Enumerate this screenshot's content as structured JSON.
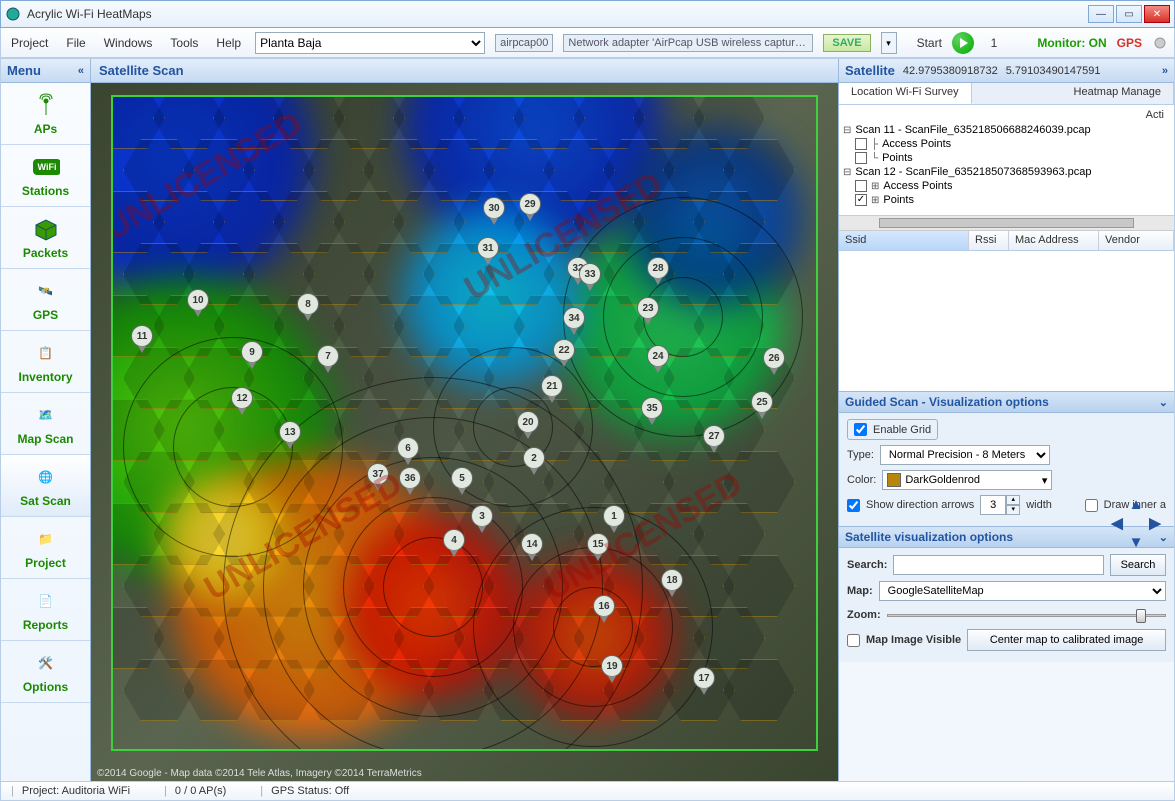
{
  "titlebar": {
    "title": "Acrylic Wi-Fi HeatMaps"
  },
  "menu": {
    "project": "Project",
    "file": "File",
    "windows": "Windows",
    "tools": "Tools",
    "help": "Help"
  },
  "toolbar": {
    "plan": "Planta Baja",
    "adapter1": "airpcap00",
    "adapter2": "Network adapter 'AirPcap USB wireless capture adapt...",
    "save": "SAVE",
    "start": "Start",
    "counter": "1",
    "monitor": "Monitor: ON",
    "gps": "GPS"
  },
  "sidebar": {
    "header": "Menu",
    "items": [
      {
        "label": "APs"
      },
      {
        "label": "Stations"
      },
      {
        "label": "Packets"
      },
      {
        "label": "GPS"
      },
      {
        "label": "Inventory"
      },
      {
        "label": "Map Scan"
      },
      {
        "label": "Sat Scan"
      },
      {
        "label": "Project"
      },
      {
        "label": "Reports"
      },
      {
        "label": "Options"
      }
    ]
  },
  "map": {
    "header": "Satellite Scan",
    "watermark": "UNLICENSED",
    "attribution": "©2014 Google - Map data ©2014 Tele Atlas, Imagery ©2014 TerraMetrics",
    "pins": [
      1,
      2,
      3,
      4,
      5,
      6,
      7,
      8,
      9,
      10,
      11,
      12,
      13,
      14,
      15,
      16,
      17,
      18,
      19,
      20,
      21,
      22,
      23,
      24,
      25,
      26,
      27,
      28,
      29,
      30,
      31,
      32,
      33,
      34,
      35,
      36,
      37
    ]
  },
  "right": {
    "header": "Satellite",
    "coord1": "42.9795380918732",
    "coord2": "5.79103490147591",
    "tabs": {
      "survey": "Location Wi-Fi Survey",
      "heatmap": "Heatmap Manage"
    },
    "actions": "Acti",
    "tree": {
      "scan11": "Scan 11 - ScanFile_635218506688246039.pcap",
      "scan11_ap": "Access Points",
      "scan11_pts": "Points",
      "scan12": "Scan 12 - ScanFile_635218507368593963.pcap",
      "scan12_ap": "Access Points",
      "scan12_pts": "Points"
    },
    "table": {
      "ssid": "Ssid",
      "rssi": "Rssi",
      "mac": "Mac Address",
      "vendor": "Vendor"
    },
    "guided": {
      "title": "Guided Scan - Visualization options",
      "enable_grid": "Enable Grid",
      "type_label": "Type:",
      "type_value": "Normal Precision - 8 Meters",
      "color_label": "Color:",
      "color_value": "DarkGoldenrod",
      "arrows": "Show direction arrows",
      "arrows_width": "3",
      "width_label": "width",
      "draw_inner": "Draw inner a"
    },
    "satvis": {
      "title": "Satellite visualization options",
      "search_label": "Search:",
      "search_btn": "Search",
      "map_label": "Map:",
      "map_value": "GoogleSatelliteMap",
      "zoom_label": "Zoom:",
      "mapvis": "Map Image Visible",
      "center": "Center map to calibrated image"
    }
  },
  "status": {
    "project": "Project: Auditoria WiFi",
    "aps": "0 / 0 AP(s)",
    "gps": "GPS Status: Off"
  }
}
